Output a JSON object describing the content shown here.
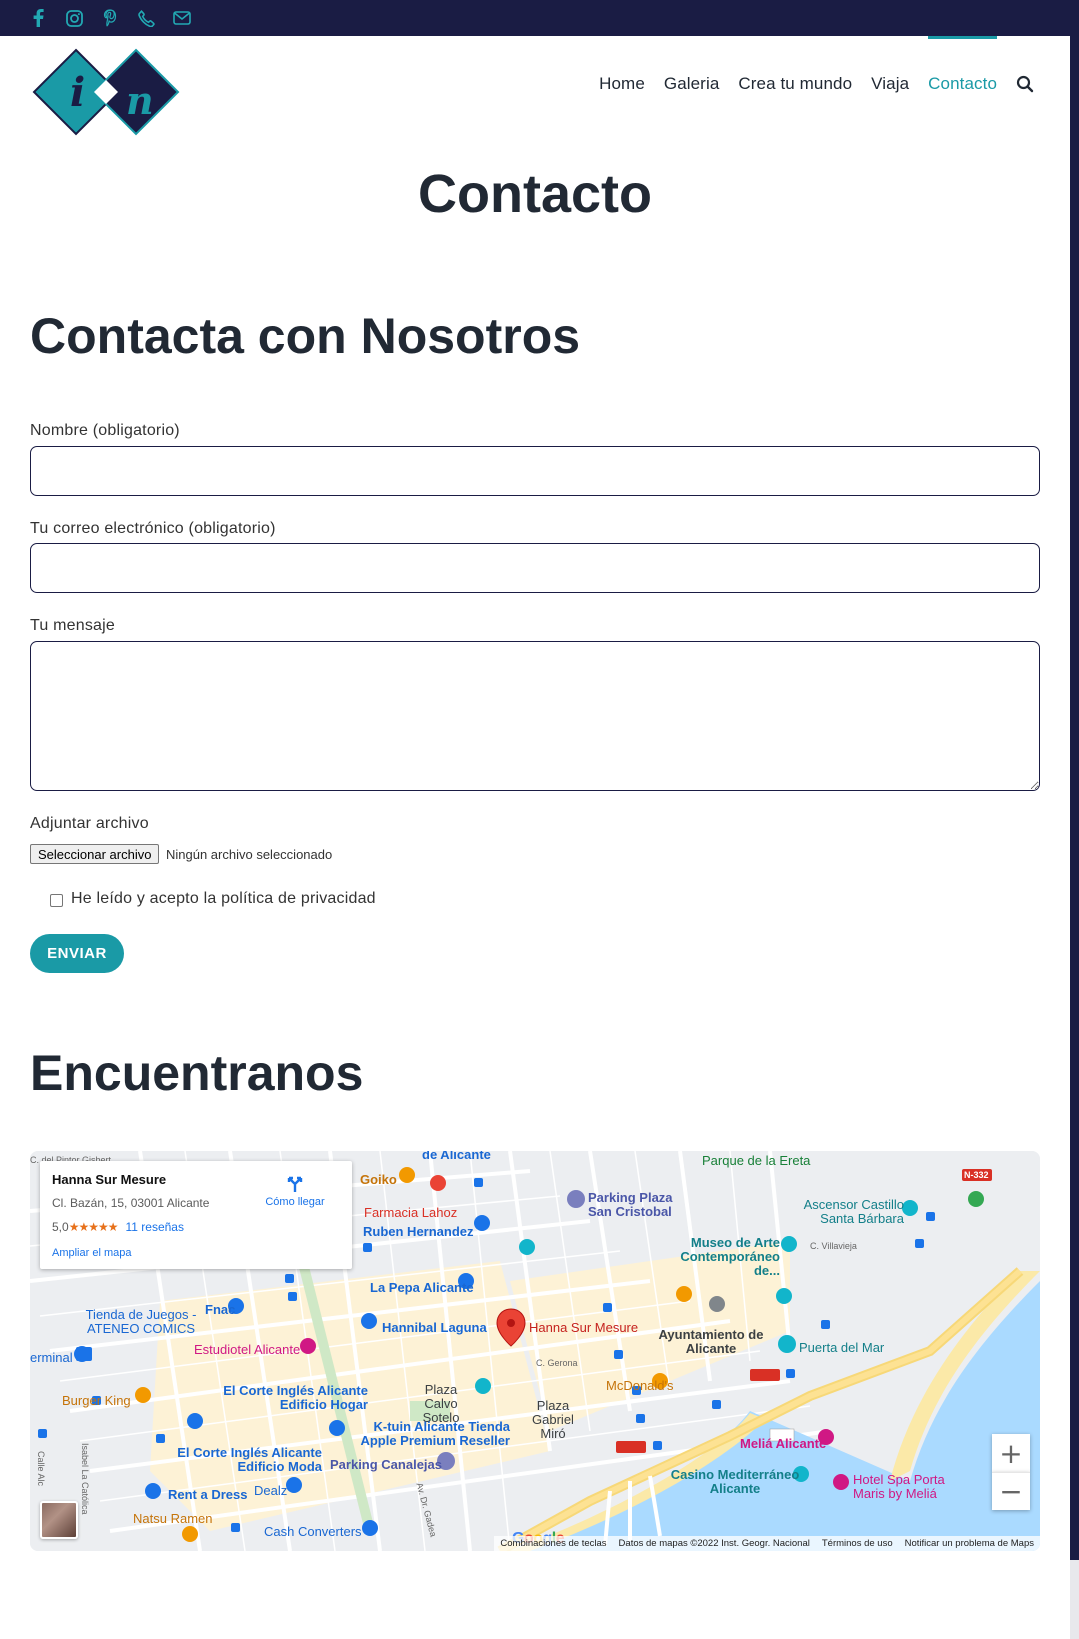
{
  "topbar": {
    "icons": [
      "facebook-icon",
      "instagram-icon",
      "pinterest-icon",
      "phone-icon",
      "mail-icon"
    ],
    "accent": "#22a9b3",
    "background": "#1a1c44"
  },
  "nav": {
    "items": [
      {
        "label": "Home"
      },
      {
        "label": "Galeria"
      },
      {
        "label": "Crea tu mundo"
      },
      {
        "label": "Viaja"
      },
      {
        "label": "Contacto",
        "active": true
      }
    ],
    "active_color": "#1a9aa6"
  },
  "page": {
    "title": "Contacto",
    "contact_heading": "Contacta con Nosotros",
    "map_heading": "Encuentranos"
  },
  "form": {
    "name_label": "Nombre (obligatorio)",
    "name_value": "",
    "email_label": "Tu correo electrónico (obligatorio)",
    "email_value": "",
    "message_label": "Tu mensaje",
    "message_value": "",
    "file_label": "Adjuntar archivo",
    "file_button": "Seleccionar archivo",
    "file_status": "Ningún archivo seleccionado",
    "privacy_label": "He leído y acepto la política de privacidad",
    "privacy_checked": false,
    "submit_label": "ENVIAR"
  },
  "map": {
    "place_name": "Hanna Sur Mesure",
    "address": "Cl. Bazán, 15, 03001 Alicante",
    "rating": "5,0",
    "stars": "★★★★★",
    "reviews": "11 reseñas",
    "directions": "Cómo llegar",
    "enlarge": "Ampliar el mapa",
    "zoom_in": "+",
    "zoom_out": "−",
    "attribution": [
      "Combinaciones de teclas",
      "Datos de mapas ©2022 Inst. Geogr. Nacional",
      "Términos de uso",
      "Notificar un problema de Maps"
    ],
    "google": "Google",
    "labels": [
      {
        "text": "C. del Pintor Gisbert",
        "color": "#666"
      },
      {
        "text": "de Alicante",
        "color": "#1967d2"
      },
      {
        "text": "Parque de la Ereta",
        "color": "#188038"
      },
      {
        "text": "N-332",
        "color": "#fff"
      },
      {
        "text": "Goiko",
        "color": "#c5740a"
      },
      {
        "text": "Parking Plaza San Cristobal",
        "color": "#4a56a8"
      },
      {
        "text": "Farmacia Lahoz",
        "color": "#d93025"
      },
      {
        "text": "Ruben Hernandez",
        "color": "#1967d2"
      },
      {
        "text": "Ascensor Castillo Santa Bárbara",
        "color": "#137f89"
      },
      {
        "text": "Museo de Arte Contemporáneo de...",
        "color": "#137f89"
      },
      {
        "text": "C. Villavieja",
        "color": "#666"
      },
      {
        "text": "La Pepa Alicante",
        "color": "#1967d2"
      },
      {
        "text": "Tienda de Juegos - ATENEO COMICS",
        "color": "#1967d2"
      },
      {
        "text": "Fnac",
        "color": "#1967d2"
      },
      {
        "text": "Hannibal Laguna",
        "color": "#1967d2"
      },
      {
        "text": "Hanna Sur Mesure",
        "color": "#c5221f"
      },
      {
        "text": "Ayuntamiento de Alicante",
        "color": "#3c4043"
      },
      {
        "text": "erminal",
        "color": "#1967d2"
      },
      {
        "text": "Estudiotel Alicante",
        "color": "#d01884"
      },
      {
        "text": "Puerta del Mar",
        "color": "#137f89"
      },
      {
        "text": "C. Gerona",
        "color": "#666"
      },
      {
        "text": "El Corte Inglés Alicante Edificio Hogar",
        "color": "#1967d2"
      },
      {
        "text": "Plaza Calvo Sotelo",
        "color": "#3c4043"
      },
      {
        "text": "McDonald's",
        "color": "#c5740a"
      },
      {
        "text": "Burger King",
        "color": "#c5740a"
      },
      {
        "text": "K-tuin Alicante Tienda Apple Premium Reseller",
        "color": "#1967d2"
      },
      {
        "text": "Plaza Gabriel Miró",
        "color": "#3c4043"
      },
      {
        "text": "Meliá Alicante",
        "color": "#d01884"
      },
      {
        "text": "El Corte Inglés Alicante Edificio Moda",
        "color": "#1967d2"
      },
      {
        "text": "Parking Canalejas",
        "color": "#4a56a8"
      },
      {
        "text": "Casino Mediterráneo Alicante",
        "color": "#137f89"
      },
      {
        "text": "Hotel Spa Porta Maris by Meliá",
        "color": "#d01884"
      },
      {
        "text": "Rent a Dress",
        "color": "#1967d2"
      },
      {
        "text": "Dealz",
        "color": "#1967d2"
      },
      {
        "text": "Natsu Ramen",
        "color": "#c5740a"
      },
      {
        "text": "Cash Converters",
        "color": "#1967d2"
      },
      {
        "text": "Calle Alc",
        "color": "#666"
      },
      {
        "text": "Isabel La Católica",
        "color": "#666"
      },
      {
        "text": "Av. Dr. Gadea",
        "color": "#666"
      }
    ]
  }
}
